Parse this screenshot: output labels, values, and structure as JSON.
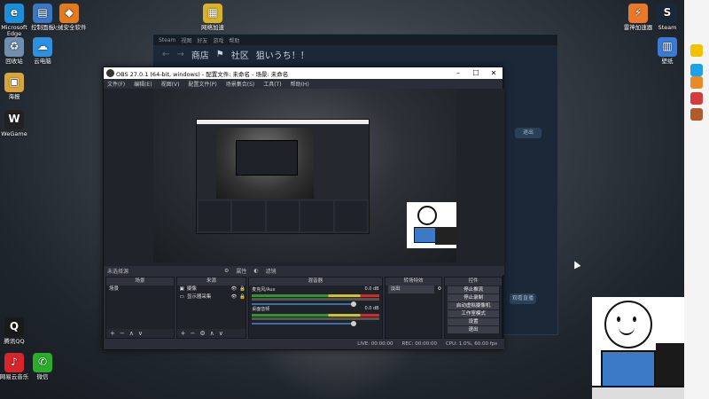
{
  "desktop": {
    "icons_left": [
      {
        "label": "Microsoft Edge",
        "color": "#1d8ed8",
        "glyph": "e"
      },
      {
        "label": "回收站",
        "color": "#6f8fb1",
        "glyph": "♻"
      },
      {
        "label": "海报",
        "color": "#d9a53b",
        "glyph": "▣"
      },
      {
        "label": "WeGame",
        "color": "#222222",
        "glyph": "W"
      },
      {
        "label": "腾讯QQ",
        "color": "#1a1a1a",
        "glyph": "Q"
      },
      {
        "label": "网易云音乐",
        "color": "#d6262b",
        "glyph": "♪"
      }
    ],
    "icons_col2": [
      {
        "label": "控制面板",
        "color": "#3b78c3",
        "glyph": "▤"
      },
      {
        "label": "火绒安全软件",
        "color": "#e47a20",
        "glyph": "◆"
      },
      {
        "label": "云电脑",
        "color": "#2f8fe0",
        "glyph": "☁"
      },
      {
        "label": "微信",
        "color": "#2aae2a",
        "glyph": "✆"
      }
    ],
    "icon_top_mid": {
      "label": "网络加速",
      "color": "#d8b32a",
      "glyph": "▦"
    },
    "icons_right": [
      {
        "label": "雷神加速器",
        "color": "#e8792b",
        "glyph": "⚡"
      },
      {
        "label": "Steam",
        "color": "#1b2838",
        "glyph": "S"
      },
      {
        "label": "壁纸",
        "color": "#3a7bd5",
        "glyph": "▥"
      }
    ]
  },
  "steam": {
    "menu": [
      "Steam",
      "视图",
      "好友",
      "游戏",
      "帮助"
    ],
    "nav_store": "商店",
    "nav_community": "社区",
    "nav_user": "狙いうち！！",
    "btn_exit": "退出",
    "btn_record": "观看直播"
  },
  "obs": {
    "title": "OBS 27.0.1 (64-bit, windows) - 配置文件: 未命名 - 场景: 未命名",
    "menu": [
      "文件(F)",
      "编辑(E)",
      "视图(V)",
      "配置文件(P)",
      "场景集合(S)",
      "工具(T)",
      "帮助(H)"
    ],
    "source_hint": "未选择源",
    "props_btn": "属性",
    "filters_btn": "滤镜",
    "docks": {
      "scenes": {
        "header": "场景",
        "items": [
          "场景"
        ]
      },
      "sources": {
        "header": "来源",
        "items": [
          "摄像",
          "显示器采集"
        ]
      },
      "mixer": {
        "header": "混音器",
        "channels": [
          {
            "name": "麦克风/Aux",
            "db": "0.0 dB"
          },
          {
            "name": "桌面音频",
            "db": "0.0 dB"
          }
        ]
      },
      "transitions": {
        "header": "转场特效",
        "type": "淡出"
      },
      "controls": {
        "header": "控件",
        "buttons": [
          "停止推流",
          "停止录制",
          "启动虚拟摄像机",
          "工作室模式",
          "设置",
          "退出"
        ]
      }
    },
    "status": {
      "live": "LIVE: 00:00:00",
      "rec": "REC: 00:00:00",
      "cpu": "CPU: 1.0%, 60.00 fps"
    }
  }
}
